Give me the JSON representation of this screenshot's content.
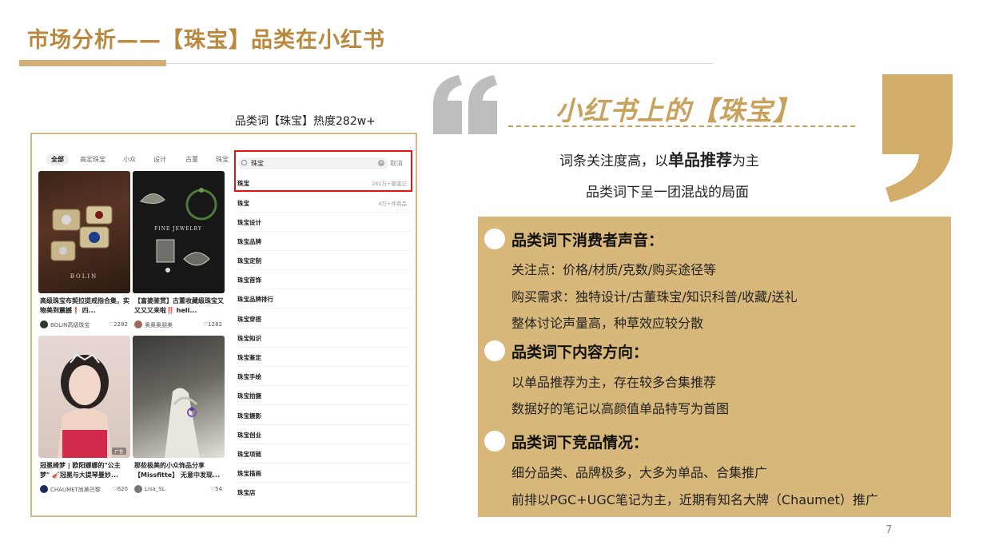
{
  "slide": {
    "title": "市场分析——【珠宝】品类在小红书",
    "caption": "品类词【珠宝】热度282w+",
    "page_number": "7"
  },
  "feed": {
    "tabs": [
      "全部",
      "高定珠宝",
      "小众",
      "设计",
      "古董",
      "珠宝"
    ],
    "cards": [
      {
        "desc": "高级珠宝布契拉提戒指合集，实物美到震撼❗ 四...",
        "author": "BOLIN高级珠宝",
        "likes": "♡2282",
        "img_text": "BOLIN"
      },
      {
        "desc": "【富婆鉴赏】古董收藏级珠宝又又又又来啦‼️ hell...",
        "author": "奥奥奥朋美",
        "likes": "♡1282",
        "img_text": "FINE JEWELRY"
      },
      {
        "desc": "冠冕绮梦 | 欧阳娜娜的\"公主梦\" 🎻冠冕与大提琴曼妙...",
        "author": "CHAUMET尚美巴黎",
        "likes": "♡620",
        "img_text": "广告"
      },
      {
        "desc": "那些极美的小众饰品分享【Missfitte】 无意中发现...",
        "author": "Lisa_SL",
        "likes": "♡54",
        "img_text": ""
      }
    ]
  },
  "search": {
    "query": "珠宝",
    "cancel": "取消",
    "suggestions": [
      {
        "keyword": "珠宝",
        "right": "281万+篇笔记"
      },
      {
        "keyword": "珠宝",
        "right": "4万+件商品"
      },
      {
        "keyword": "珠宝设计",
        "right": ""
      },
      {
        "keyword": "珠宝品牌",
        "right": ""
      },
      {
        "keyword": "珠宝定制",
        "right": ""
      },
      {
        "keyword": "珠宝首饰",
        "right": ""
      },
      {
        "keyword": "珠宝品牌排行",
        "right": ""
      },
      {
        "keyword": "珠宝穿搭",
        "right": ""
      },
      {
        "keyword": "珠宝知识",
        "right": ""
      },
      {
        "keyword": "珠宝鉴定",
        "right": ""
      },
      {
        "keyword": "珠宝手绘",
        "right": ""
      },
      {
        "keyword": "珠宝拍摄",
        "right": ""
      },
      {
        "keyword": "珠宝摄影",
        "right": ""
      },
      {
        "keyword": "珠宝创业",
        "right": ""
      },
      {
        "keyword": "珠宝项链",
        "right": ""
      },
      {
        "keyword": "珠宝插画",
        "right": ""
      },
      {
        "keyword": "珠宝店",
        "right": ""
      }
    ]
  },
  "summary": {
    "headline": "小红书上的【珠宝】",
    "sub1_pre": "词条关注度高，以",
    "sub1_bold": "单品推荐",
    "sub1_post": "为主",
    "sub2": "品类词下呈一团混战的局面"
  },
  "sections": [
    {
      "title": "品类词下消费者声音：",
      "lines": [
        "关注点：价格/材质/克数/购买途径等",
        "购买需求：独特设计/古董珠宝/知识科普/收藏/送礼",
        "整体讨论声量高，种草效应较分散"
      ]
    },
    {
      "title": "品类词下内容方向：",
      "lines": [
        "以单品推荐为主，存在较多合集推荐",
        "数据好的笔记以高颜值单品特写为首图"
      ]
    },
    {
      "title": "品类词下竞品情况：",
      "lines": [
        "细分品类、品牌极多，大多为单品、合集推广",
        "前排以PGC+UGC笔记为主，近期有知名大牌（Chaumet）推广"
      ]
    }
  ],
  "colors": {
    "accent": "#c8a15c",
    "gold_box": "#d8b87a",
    "highlight_red": "#e3140f"
  }
}
